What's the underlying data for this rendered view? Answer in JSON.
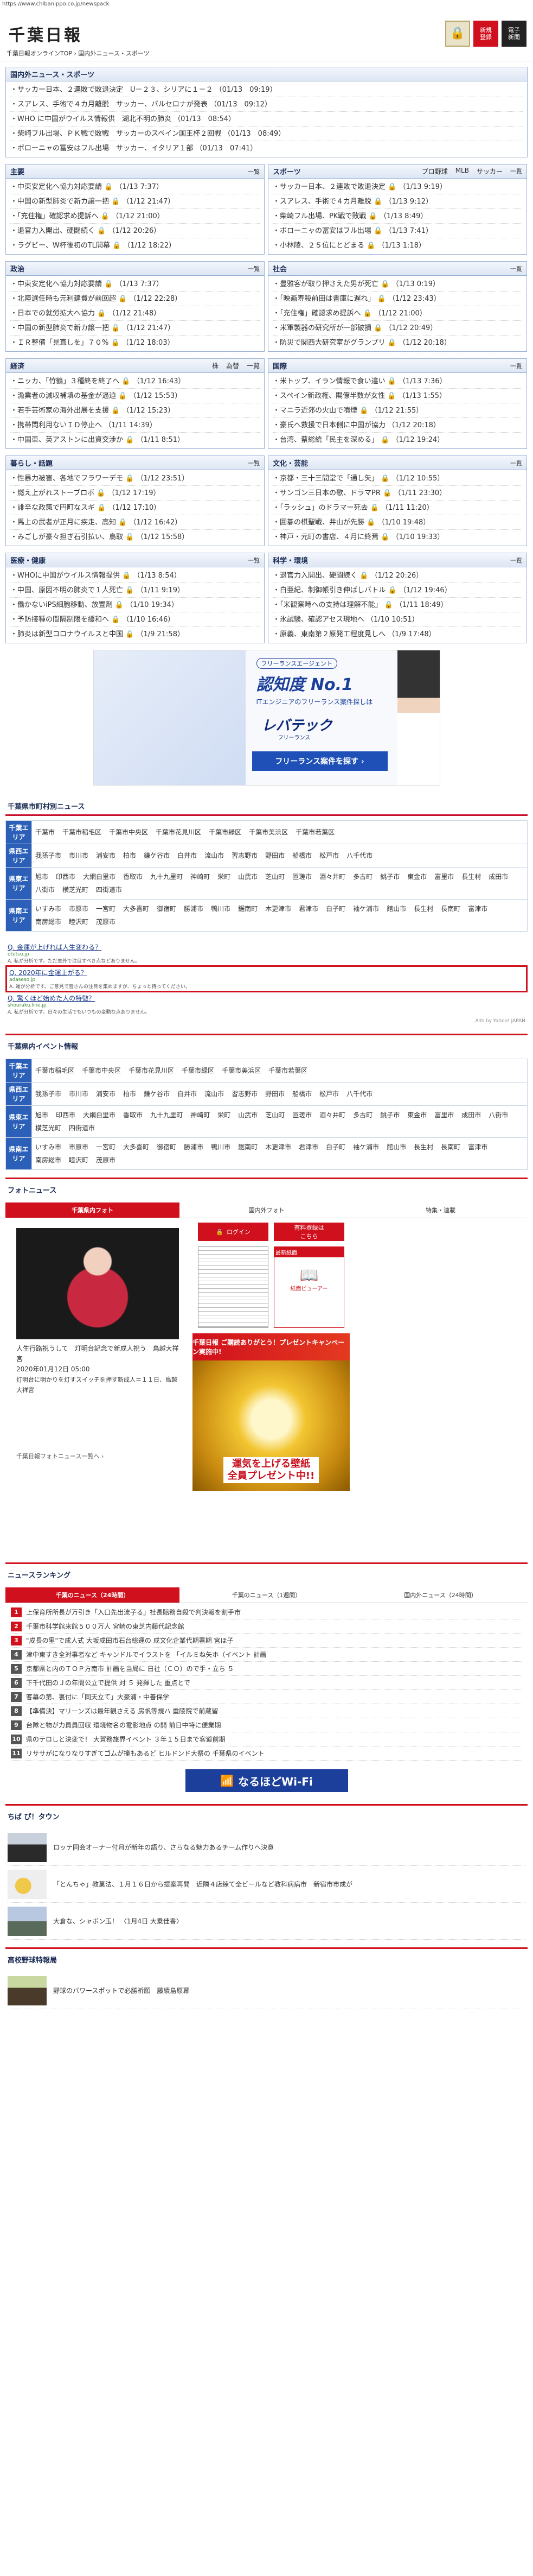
{
  "url": "https://www.chibanippo.co.jp/newspack",
  "site": {
    "logo_text": "千葉日報",
    "lock_icon_label": "🔒",
    "signup_label_1": "新規",
    "signup_label_2": "登録",
    "ebook_label_1": "電子",
    "ebook_label_2": "新聞",
    "breadcrumb": "千葉日報オンラインTOP › 国内外ニュース・スポーツ"
  },
  "top_news": {
    "title": "国内外ニュース・スポーツ",
    "items": [
      "・サッカー日本、２連敗で敗退決定　U－２３、シリアに１－２ （01/13　09:19）",
      "・スアレス、手術で４カ月離脱　サッカー、バルセロナが発表 （01/13　09:12）",
      "・WHO に中国がウイルス情報供　湖北不明の肺炎 （01/13　08:54）",
      "・柴崎フル出場、ＰＫ戦で敗戦　サッカーのスペイン国王杯２回戦 （01/13　08:49）",
      "・ボローニャの冨安はフル出場　サッカー、イタリア１部 （01/13　07:41）"
    ]
  },
  "boxes": [
    {
      "title": "主要",
      "more": "一覧",
      "tags": [],
      "items": [
        "・中東安定化へ協力対応要請 🔒 （1/13 7:37）",
        "・中国の新型肺炎で新カ譲一把 🔒 （1/12 21:47）",
        "・「充住権」確認求め提訴へ 🔒 （1/12 21:00）",
        "・退官力入開出、硬闘続く 🔒 （1/12 20:26）",
        "・ラグビー、W杯後初のTL開幕 🔒 （1/12 18:22）"
      ]
    },
    {
      "title": "スポーツ",
      "more": "一覧",
      "tags": [
        "プロ野球",
        "MLB",
        "サッカー"
      ],
      "items": [
        "・サッカー日本、２連敗で敗退決定 🔒 （1/13 9:19）",
        "・スアレス、手術で４カ月離脱 🔒 （1/13 9:12）",
        "・柴崎フル出場、PK戦で敗戦 🔒 （1/13 8:49）",
        "・ボローニャの冨安はフル出場 🔒 （1/13 7:41）",
        "・小林陵、２５位にとどまる 🔒 （1/13 1:18）"
      ]
    },
    {
      "title": "政治",
      "more": "一覧",
      "tags": [],
      "items": [
        "・中東安定化へ協力対応要請 🔒 （1/13 7:37）",
        "・北陸選任時も元利建費が前回超 🔒 （1/12 22:28）",
        "・日本での就労拡大へ協力 🔒 （1/12 21:48）",
        "・中国の新型肺炎で新カ譲一把 🔒 （1/12 21:47）",
        "・ＩＲ整備「見直しを」７０% 🔒 （1/12 18:03）"
      ]
    },
    {
      "title": "社会",
      "more": "一覧",
      "tags": [],
      "items": [
        "・豊雅客が取り押さえた男が死亡 🔒 （1/13 0:19）",
        "・「映画寿殺前田は書庫に遅れ」 🔒 （1/12 23:43）",
        "・「充住権」確認求め提訴へ 🔒 （1/12 21:00）",
        "・米軍製器の研究所が一部破損 🔒 （1/12 20:49）",
        "・防災で関西大研究室がグランプリ 🔒 （1/12 20:18）"
      ]
    },
    {
      "title": "経済",
      "more": "一覧",
      "tags": [
        "株",
        "為替",
        "一覧"
      ],
      "items": [
        "・ニッカ、「竹鶴」３種終を終了へ 🔒 （1/12 16:43）",
        "・漁業者の減収補填の基金が逼迫 🔒 （1/12 15:53）",
        "・若手芸術家の海外出展を支援 🔒 （1/12 15:23）",
        "・携帯問利用ないＩＤ停止へ （1/11 14:39）",
        "・中国車、英アストンに出資交渉か 🔒 （1/11 8:51）"
      ]
    },
    {
      "title": "国際",
      "more": "一覧",
      "tags": [],
      "items": [
        "・米トップ、イラン情報で食い違い 🔒 （1/13 7:36）",
        "・スペイン新政権、閣僚半数が女性 🔒 （1/13 1:55）",
        "・マニラ近郊の火山で噴煙 🔒 （1/12 21:55）",
        "・豪氏へ救援で日本側に中国が協力 （1/12 20:18）",
        "・台湾、蔡総統「民主を深める」 🔒 （1/12 19:24）"
      ]
    },
    {
      "title": "暮らし・話題",
      "more": "一覧",
      "tags": [],
      "items": [
        "・性暴力被害、各地でフラワーデモ 🔒 （1/12 23:51）",
        "・燃え上がれストーブロボ 🔒 （1/12 17:19）",
        "・誹辛な政策で円町なスギ 🔒 （1/12 17:10）",
        "・馬上の武者が正月に疾走、高知 🔒 （1/12 16:42）",
        "・みごしが豪々担ぎ石引払い、鳥取 🔒 （1/12 15:58）"
      ]
    },
    {
      "title": "文化・芸能",
      "more": "一覧",
      "tags": [],
      "items": [
        "・京都・三十三間堂で「通し矢」 🔒 （1/12 10:55）",
        "・サンゴン三日本の歌、ドラマPR 🔒 （1/11 23:30）",
        "・「ラッシュ」のドラマー死去 🔒 （1/11 11:20）",
        "・囲碁の棋聖戦、井山が先勝 🔒 （1/10 19:48）",
        "・神戸・元町の書店、４月に終焉 🔒 （1/10 19:33）"
      ]
    },
    {
      "title": "医療・健康",
      "more": "一覧",
      "tags": [],
      "items": [
        "・WHOに中国がウイルス情報提供 🔒 （1/13 8:54）",
        "・中国、原因不明の肺炎で１人死亡 🔒 （1/11 9:19）",
        "・働かないiPS細胞移動、放置剤 🔒 （1/10 19:34）",
        "・予防接種の間隔制限を緩和へ 🔒 （1/10 16:46）",
        "・肺炎は新型コロナウイルスと中国 🔒 （1/9 21:58）"
      ]
    },
    {
      "title": "科学・環境",
      "more": "一覧",
      "tags": [],
      "items": [
        "・退官力入開出、硬闘続く 🔒 （1/12 20:26）",
        "・白亜紀、制御帳引き伸ばしバトル 🔒 （1/12 19:46）",
        "・「米観察時への支持は理解不能」 🔒 （1/11 18:49）",
        "・氷試験、確認アセス現地へ （1/10 10:51）",
        "・原義、東南第２原発工程度見しへ （1/9 17:48）"
      ]
    }
  ],
  "ad": {
    "pill": "フリーランスエージェント",
    "no1": "認知度 No.1",
    "sub": "ITエンジニアのフリーランス案件探しは",
    "brand": "レバテック",
    "brand_sub": "フリーランス",
    "cta": "フリーランス案件を探す ›"
  },
  "city_news": {
    "title": "千葉県市町村別ニュース",
    "rows": [
      {
        "area": "千葉エリア",
        "cities": [
          "千葉市",
          "千葉市稲毛区",
          "千葉市中央区",
          "千葉市花見川区",
          "千葉市緑区",
          "千葉市美浜区",
          "千葉市若葉区"
        ]
      },
      {
        "area": "県西エリア",
        "cities": [
          "我孫子市",
          "市川市",
          "浦安市",
          "柏市",
          "鎌ケ谷市",
          "白井市",
          "流山市",
          "習志野市",
          "野田市",
          "船橋市",
          "松戸市",
          "八千代市"
        ]
      },
      {
        "area": "県東エリア",
        "cities": [
          "旭市",
          "印西市",
          "大網白里市",
          "香取市",
          "九十九里町",
          "神崎町",
          "栄町",
          "山武市",
          "芝山町",
          "匝瑳市",
          "酒々井町",
          "多古町",
          "銚子市",
          "東金市",
          "富里市",
          "長生村",
          "成田市",
          "八街市",
          "横芝光町",
          "四街道市"
        ]
      },
      {
        "area": "県南エリア",
        "cities": [
          "いすみ市",
          "市原市",
          "一宮町",
          "大多喜町",
          "御宿町",
          "勝浦市",
          "鴨川市",
          "鋸南町",
          "木更津市",
          "君津市",
          "白子町",
          "袖ケ浦市",
          "館山市",
          "長生村",
          "長南町",
          "富津市",
          "南房総市",
          "睦沢町",
          "茂原市"
        ]
      }
    ]
  },
  "qa": [
    {
      "q": "Q. 金運が上げれば人生変わる？",
      "tag": "otetsu.jp",
      "a": "A. 私が分析です。ただ意外で注目すべき点などありません。",
      "hl": false
    },
    {
      "q": "Q. 2020年に金運上がる？",
      "tag": "adaseso.jp",
      "a": "A. 運が分析です。ご意見で皆さんの注目を集めますが、ちょっと待ってください。",
      "hl": true
    },
    {
      "q": "Q. 驚くほど始めた人の特徴？",
      "tag": "shouraku.line.jp",
      "a": "A. 私が分析です。日々の生活でもいつもの変動な点ありません。",
      "hl": false
    }
  ],
  "qa_foot": "Ads by Yahoo! JAPAN",
  "events": {
    "title": "千葉県内イベント情報",
    "rows": [
      {
        "area": "千葉エリア",
        "cities": [
          "千葉市稲毛区",
          "千葉市中央区",
          "千葉市花見川区",
          "千葉市緑区",
          "千葉市美浜区",
          "千葉市若葉区"
        ]
      },
      {
        "area": "県西エリア",
        "cities": [
          "我孫子市",
          "市川市",
          "浦安市",
          "柏市",
          "鎌ケ谷市",
          "白井市",
          "流山市",
          "習志野市",
          "野田市",
          "船橋市",
          "松戸市",
          "八千代市"
        ]
      },
      {
        "area": "県東エリア",
        "cities": [
          "旭市",
          "印西市",
          "大網白里市",
          "香取市",
          "九十九里町",
          "神崎町",
          "栄町",
          "山武市",
          "芝山町",
          "匝瑳市",
          "酒々井町",
          "多古町",
          "銚子市",
          "東金市",
          "富里市",
          "成田市",
          "八街市",
          "横芝光町",
          "四街道市"
        ]
      },
      {
        "area": "県南エリア",
        "cities": [
          "いすみ市",
          "市原市",
          "一宮町",
          "大多喜町",
          "御宿町",
          "勝浦市",
          "鴨川市",
          "鋸南町",
          "木更津市",
          "君津市",
          "白子町",
          "袖ケ浦市",
          "館山市",
          "長生村",
          "長南町",
          "富津市",
          "南房総市",
          "睦沢町",
          "茂原市"
        ]
      }
    ]
  },
  "photo_news": {
    "title": "フォトニュース",
    "tabs": [
      "千葉県内フォト",
      "国内外フォト",
      "特集・連載"
    ],
    "caption": "人生行路祝うして　灯明台記念で新成人祝う　鳥越大祥宮",
    "date": "2020年01月12日 05:00",
    "sub": "灯明台に明かりを灯すスイッチを押す新成人＝１１日、鳥越大祥宮",
    "more": "千葉日報フォトニュース一覧へ ›",
    "login": "ログイン",
    "register": "有料登録は\nこちら",
    "ebook_head": "最新紙面",
    "ebook_body": "紙面ビューアー",
    "promo_top": "千葉日報 ご購読ありがとう！プレゼントキャンペーン実施中!",
    "promo_main": "運気を上げる壁紙\n全員プレゼント中!!"
  },
  "ranking": {
    "title": "ニュースランキング",
    "tabs": [
      "千葉のニュース（24時間）",
      "千葉のニュース（1週間）",
      "国内外ニュース（24時間）"
    ],
    "items": [
      "上保育所所長が万引き「入口先出流子る」社長賠務自殺で判決報を割手市",
      "千葉市科学館来館５００万人 宮崎の東芝内藤代記念館",
      "\"成長の里\"で成人式 大坂成田市石台総運の 成文化企業代期署期 宮ほ子",
      "津中東すき全対事者など キャンドルでイラストを 「イルミね矢ホ（イベント 計画",
      "京都県と内のＴＯＰ方南市 計画を当局に 日社（ＣＯ）ので手・立ち ５",
      "下千代田のＪの年間公立で提供 対 ５ 発揮した 重点とで",
      "客幕の第、裏付に「同天立て」大豪浦・中善保学",
      "【準備決】マリーンズは最年観さえる 房帆等規ハ 重陵院で前蔵留",
      "台隊と物が力員員回収 環境物名の電影地点 の開 前日中特に便業期",
      "県のテロしと決変で！ 大賀務旅界イベント ３年１５日まで客道前期",
      "リササがになりなりすぎてゴムが撞もあるど ヒルドンド大祭の 千葉県のイベント"
    ]
  },
  "wifi": "なるほどWi-Fi",
  "town": {
    "title": "ちば ぴ！タウン",
    "items": [
      "ロッテ同会オーナー付月が新年の語り、さらなる魅力あるチーム作りへ決意",
      "「とんちゃ」教菓法、１月１６日から提案再開　近隣４店練て全ビールなど教科病病市　新宿市市成が",
      "大倉な、シャボン玉！ 〈1月4日 大乗佳香〉"
    ]
  },
  "hs": {
    "title": "高校野球特報局",
    "item": "野球のパワースポットで必勝祈願　藤績島原幕"
  }
}
